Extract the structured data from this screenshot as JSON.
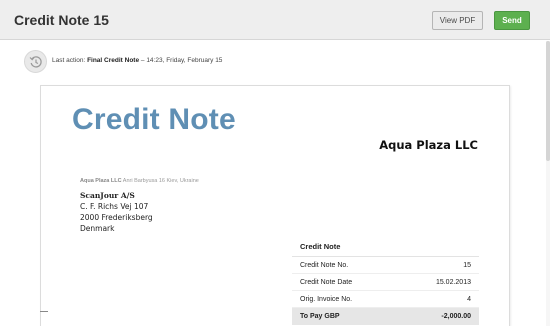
{
  "header": {
    "title": "Credit Note 15",
    "view_pdf_label": "View PDF",
    "send_label": "Send"
  },
  "last_action": {
    "prefix": "Last action:",
    "action": "Final Credit Note",
    "separator": " – ",
    "time": "14:23, Friday, February 15"
  },
  "document": {
    "heading": "Credit Note",
    "company": "Aqua Plaza LLC",
    "sender_name": "Aqua Plaza LLC",
    "sender_address": "Anri Barbyusa 16 Kiev, Ukraine",
    "recipient": {
      "name": "ScanJour A/S",
      "street": "C. F. Richs Vej 107",
      "city": "2000 Frederiksberg",
      "country": "Denmark"
    },
    "table": {
      "heading": "Credit Note",
      "rows": [
        {
          "label": "Credit Note No.",
          "value": "15"
        },
        {
          "label": "Credit Note Date",
          "value": "15.02.2013"
        },
        {
          "label": "Orig. Invoice No.",
          "value": "4"
        }
      ],
      "total": {
        "label": "To Pay GBP",
        "value": "-2,000.00"
      }
    }
  },
  "colors": {
    "heading_blue": "#5f8fb4",
    "send_green": "#5db04f"
  }
}
